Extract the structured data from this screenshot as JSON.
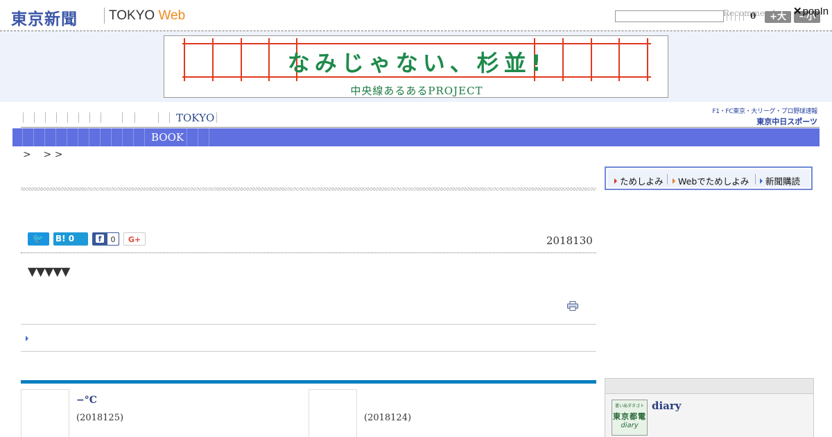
{
  "header": {
    "logo_jp": "東京新聞",
    "logo_tokyo": "TOKYO",
    "logo_web": "Web",
    "recommend": "Recommend",
    "count": "0",
    "font_large": "+大",
    "font_small": "−小",
    "popin": "popIn"
  },
  "banner": {
    "main": "なみじゃない、杉並!",
    "sub": "中央線あるあるPROJECT"
  },
  "nav": {
    "tokyo": "TOKYO",
    "chunichi_line1": "F1・FC東京・大リーグ・プロ野球速報",
    "chunichi_line2": "東京中日スポーツ",
    "book": "BOOK",
    "breadcrumb": ">    > >"
  },
  "article": {
    "tw_icon": "🐦",
    "hatena": "B! 0",
    "fb_count": "0",
    "gplus": "G+",
    "date": "2018130",
    "triangles": "▼▼▼▼▼"
  },
  "related": [
    {
      "title": "−°C",
      "date": "(2018125)"
    },
    {
      "title": "",
      "date": "(2018124)"
    }
  ],
  "side": {
    "links": [
      "ためしよみ",
      "Webでためしよみ",
      "新聞購読"
    ],
    "diary_thumb_top": "書い出ダタゴト",
    "diary_thumb_mid": "東京都電",
    "diary_thumb_bottom": "diary",
    "diary_label": "diary"
  }
}
